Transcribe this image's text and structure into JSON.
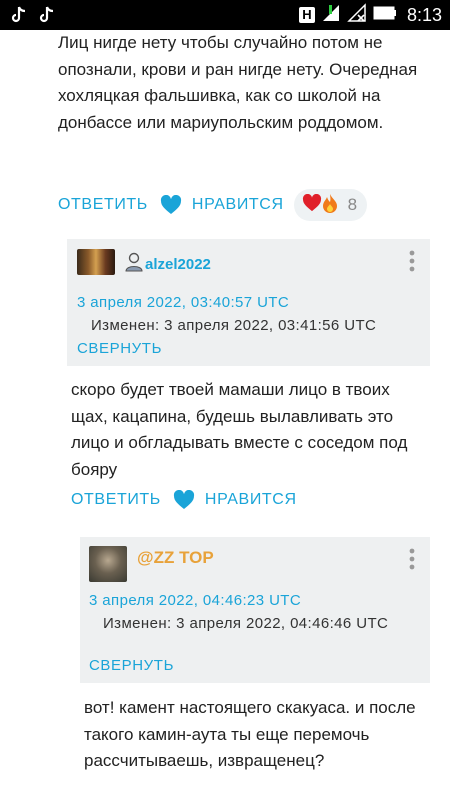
{
  "status_bar": {
    "time": "8:13",
    "carrier_badge": "H",
    "icons": [
      "tiktok-icon",
      "tiktok-icon",
      "signal-icon",
      "no-sim-icon",
      "battery-icon"
    ]
  },
  "top_comment": {
    "text": "Лиц нигде нету чтобы случайно потом не опознали, крови и ран нигде нету. Очередная хохляцкая фальшивка, как со школой на донбассе или мариупольским роддомом.",
    "reply_label": "ОТВЕТИТЬ",
    "like_label": "НРАВИТСЯ",
    "reactions": [
      "heart",
      "fire"
    ],
    "reaction_count": "8"
  },
  "reply1": {
    "author": "alzel2022",
    "date": "3 апреля 2022, 03:40:57 UTC",
    "edited": "Изменен:  3 апреля 2022, 03:41:56 UTC",
    "collapse_label": "СВЕРНУТЬ",
    "text": "скоро будет твоей мамаши лицо в твоих щах, кацапина, будешь вылавливать это лицо и обгладывать вместе с соседом под бояру",
    "reply_label": "ОТВЕТИТЬ",
    "like_label": "НРАВИТСЯ"
  },
  "reply2": {
    "author": "@ZZ TOP",
    "date": "3 апреля 2022, 04:46:23 UTC",
    "edited": "Изменен:  3 апреля 2022, 04:46:46 UTC",
    "collapse_label": "СВЕРНУТЬ",
    "text": "вот! камент настоящего скакуаса. и после такого камин-аута ты еще перемочь рассчитываешь, извращенец?"
  },
  "colors": {
    "accent": "#1aa4d8",
    "card_bg": "#eef0f1",
    "reaction_bg": "#eef2f4",
    "author2": "#e8a23a"
  }
}
